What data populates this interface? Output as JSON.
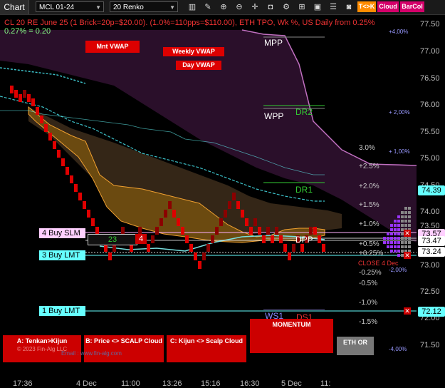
{
  "toolbar": {
    "title": "Chart",
    "instrument": "MCL 01-24",
    "bar_type": "20 Renko",
    "buttons": {
      "tk": "T<>K",
      "cloud": "Cloud",
      "barcol": "BarCol"
    }
  },
  "chart": {
    "header_line": "CL 20 RE June 25 (1 Brick=20p=$20.00). (1.0%=110pps=$110.00), ETH TPO, Wk %, US Daily from 0.25%",
    "subheader": "0.27% = 0.20",
    "vwap_labels": {
      "month": "Mnt VWAP",
      "week": "Weekly VWAP",
      "day": "Day VWAP"
    },
    "levels": {
      "mpp": "MPP",
      "wpp": "WPP",
      "dr2": "DR2",
      "dr1": "DR1",
      "dpp": "DPP",
      "ws1": "WS1",
      "ds1": "DS1"
    },
    "pct_labels": [
      "3.0%",
      "+2.5%",
      "+2.0%",
      "+1.5%",
      "+1.0%",
      "+0.5%",
      "+0.25%",
      "-0.25%",
      "-0.5%",
      "-1.0%",
      "-1.5%"
    ],
    "wk_pct_labels": [
      "+4,00%",
      "+ 2,00%",
      "+ 1,00%",
      "-2,00%",
      "-4,00%"
    ],
    "close_label": "CLOSE 4 Dec",
    "y_axis": [
      "77.50",
      "77.00",
      "76.50",
      "76.00",
      "75.50",
      "75.00",
      "74.50",
      "74.00",
      "73.50",
      "73.00",
      "72.50",
      "72.00",
      "71.50"
    ],
    "x_axis": [
      "17:36",
      "4 Dec",
      "11:00",
      "13:26",
      "15:16",
      "16:30",
      "5 Dec",
      "11:"
    ],
    "price_tags": {
      "current": "74.39",
      "upper": "73.57",
      "mid": "73.47",
      "last": "73.24",
      "lower": "72.12"
    },
    "orders": {
      "buy_slm": "4 Buy SLM",
      "buy_lmt3": "3 Buy LMT",
      "buy_lmt1": "1 Buy LMT",
      "qty_23": "23",
      "qty_4": "4"
    },
    "panel": {
      "tenkan_kijun": "A: Tenkan>Kijun",
      "price_scalp": "B: Price <> SCALP Cloud",
      "kijun_scalp": "C: Kijun <> Scalp Cloud",
      "momentum": "MOMENTUM",
      "eth_or": "ETH OR",
      "email": "Email : www.fin-alg.com",
      "copyright": "© 2023 Fin-Alg LLC"
    },
    "colors": {
      "bull": "#8b0000",
      "bear": "#e00000",
      "cloud": "#6b4a10",
      "vwap": "#3cc0c8",
      "tpo": "#9933ff"
    }
  }
}
